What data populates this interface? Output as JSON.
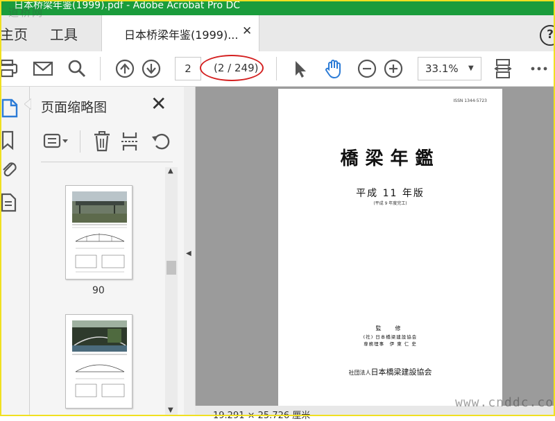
{
  "window": {
    "title": "日本桥梁年鉴(1999).pdf - Adobe Acrobat Pro DC",
    "titlebar_color": "#1a9c3c",
    "watermark_top_left": "道桥网",
    "watermark_bottom_right": "www.cnddc.com"
  },
  "tabs": {
    "home": "主页",
    "tools": "工具",
    "document": "日本桥梁年鉴(1999)...",
    "close_glyph": "✕",
    "help_glyph": "?"
  },
  "toolbar": {
    "icons": [
      "print-icon",
      "mail-icon",
      "search-icon",
      "page-up-icon",
      "page-down-icon",
      "select-arrow-icon",
      "hand-icon",
      "zoom-out-icon",
      "zoom-in-icon",
      "fit-width-icon",
      "more-icon"
    ],
    "current_page": "2",
    "page_count": "(2 / 249)",
    "zoom": "33.1%",
    "accent_color": "#2b7bd6",
    "highlight_color": "#d42020"
  },
  "side_panel": {
    "title": "页面缩略图",
    "thumbnails": [
      {
        "label": "90"
      },
      {
        "label": ""
      }
    ]
  },
  "document_page": {
    "issn": "ISSN 1344-5723",
    "title": "橋梁年鑑",
    "edition": "平成 11 年版",
    "edition_note": "(平成 9 年度完工)",
    "supervise": "監　修",
    "sup_org": "(社) 日本橋梁建設協会",
    "sup_person": "専務理事　伊 東 仁 史",
    "publisher_prefix": "社団法人",
    "publisher_name": "日本橋梁建設協会"
  },
  "status": {
    "page_size": "19.291 × 25.726 厘米"
  }
}
